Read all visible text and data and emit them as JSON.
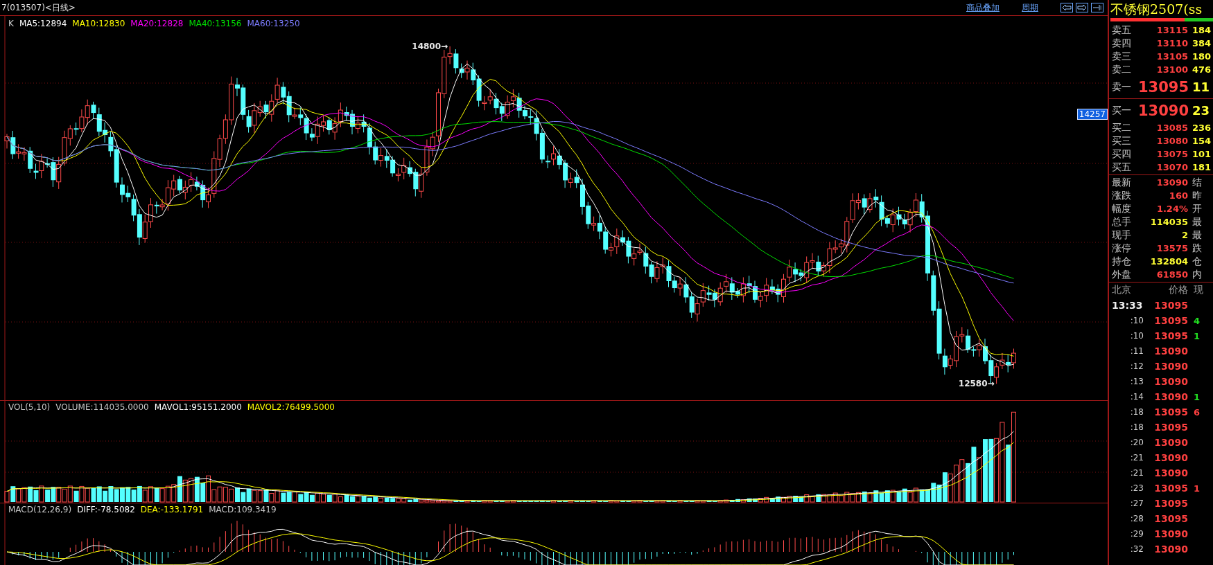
{
  "header": {
    "title": "7(013507)<日线>",
    "links": [
      "商品叠加",
      "周期"
    ]
  },
  "kline": {
    "legend": [
      {
        "text": "K",
        "color": "#c8c8c8"
      },
      {
        "text": "MA5:12894",
        "color": "#ffffff"
      },
      {
        "text": "MA10:12830",
        "color": "#ffff00"
      },
      {
        "text": "MA20:12828",
        "color": "#ff00ff"
      },
      {
        "text": "MA40:13156",
        "color": "#00e000"
      },
      {
        "text": "MA60:13250",
        "color": "#7c7cff"
      }
    ],
    "high_mark": "14800→",
    "low_mark": "12580→",
    "price_tag": "14257"
  },
  "volume": {
    "legend": [
      {
        "text": "VOL(5,10)",
        "color": "#c8c8c8"
      },
      {
        "text": "VOLUME:114035.0000",
        "color": "#c8c8c8"
      },
      {
        "text": "MAVOL1:95151.2000",
        "color": "#ffffff"
      },
      {
        "text": "MAVOL2:76499.5000",
        "color": "#ffff00"
      }
    ]
  },
  "macd": {
    "legend": [
      {
        "text": "MACD(12,26,9)",
        "color": "#c8c8c8"
      },
      {
        "text": "DIFF:-78.5082",
        "color": "#ffffff"
      },
      {
        "text": "DEA:-133.1791",
        "color": "#ffff00"
      },
      {
        "text": "MACD:109.3419",
        "color": "#c8c8c8"
      }
    ]
  },
  "quote": {
    "title": "不锈钢2507(ss",
    "ratio_bar": {
      "level": 0.72
    },
    "sell": [
      {
        "label": "卖五",
        "price": "13115",
        "volume": "184",
        "kind": "level"
      },
      {
        "label": "卖四",
        "price": "13110",
        "volume": "384",
        "kind": "level"
      },
      {
        "label": "卖三",
        "price": "13105",
        "volume": "180",
        "kind": "level"
      },
      {
        "label": "卖二",
        "price": "13100",
        "volume": "476",
        "kind": "level"
      },
      {
        "label": "卖一",
        "price": "13095",
        "volume": "11",
        "kind": "best"
      }
    ],
    "buy": [
      {
        "label": "买一",
        "price": "13090",
        "volume": "23",
        "kind": "best"
      },
      {
        "label": "买二",
        "price": "13085",
        "volume": "236",
        "kind": "level"
      },
      {
        "label": "买三",
        "price": "13080",
        "volume": "154",
        "kind": "level"
      },
      {
        "label": "买四",
        "price": "13075",
        "volume": "101",
        "kind": "level"
      },
      {
        "label": "买五",
        "price": "13070",
        "volume": "181",
        "kind": "level"
      }
    ],
    "stats": [
      {
        "label": "最新",
        "value": "13090",
        "color": "#ff4040",
        "label_2": "结"
      },
      {
        "label": "涨跌",
        "value": "160",
        "color": "#ff4040",
        "label_2": "昨"
      },
      {
        "label": "幅度",
        "value": "1.24%",
        "color": "#ff4040",
        "label_2": "开"
      },
      {
        "label": "总手",
        "value": "114035",
        "color": "#ffff33",
        "label_2": "最"
      },
      {
        "label": "现手",
        "value": "2",
        "color": "#ffff33",
        "label_2": "最"
      },
      {
        "label": "涨停",
        "value": "13575",
        "color": "#ff4040",
        "label_2": "跌"
      },
      {
        "label": "持仓",
        "value": "132804",
        "color": "#ffff33",
        "label_2": "仓"
      },
      {
        "label": "外盘",
        "value": "61850",
        "color": "#ff4040",
        "label_2": "内"
      }
    ],
    "ticks": {
      "columns": [
        "北京",
        "价格",
        "现"
      ],
      "rows": [
        {
          "time": "13:33",
          "price": "13095",
          "kind": "current"
        },
        {
          "time": ":10",
          "price": "13095",
          "volume": "4",
          "color": "#22e022",
          "kind": "tick"
        },
        {
          "time": ":10",
          "price": "13095",
          "volume": "1",
          "color": "#22e022",
          "kind": "tick"
        },
        {
          "time": ":11",
          "price": "13090",
          "kind": "tick"
        },
        {
          "time": ":12",
          "price": "13090",
          "kind": "tick"
        },
        {
          "time": ":13",
          "price": "13090",
          "kind": "tick"
        },
        {
          "time": ":14",
          "price": "13090",
          "volume": "1",
          "color": "#22e022",
          "kind": "tick"
        },
        {
          "time": ":18",
          "price": "13095",
          "volume": "6",
          "color": "#ff4040",
          "kind": "tick"
        },
        {
          "time": ":18",
          "price": "13095",
          "kind": "tick"
        },
        {
          "time": ":20",
          "price": "13090",
          "kind": "tick"
        },
        {
          "time": ":21",
          "price": "13090",
          "kind": "tick"
        },
        {
          "time": ":21",
          "price": "13090",
          "kind": "tick"
        },
        {
          "time": ":23",
          "price": "13095",
          "volume": "1",
          "color": "#ff4040",
          "kind": "tick"
        },
        {
          "time": ":27",
          "price": "13095",
          "kind": "tick"
        },
        {
          "time": ":28",
          "price": "13095",
          "kind": "tick"
        },
        {
          "time": ":29",
          "price": "13090",
          "kind": "tick"
        },
        {
          "time": ":32",
          "price": "13090",
          "kind": "tick"
        }
      ]
    }
  }
}
